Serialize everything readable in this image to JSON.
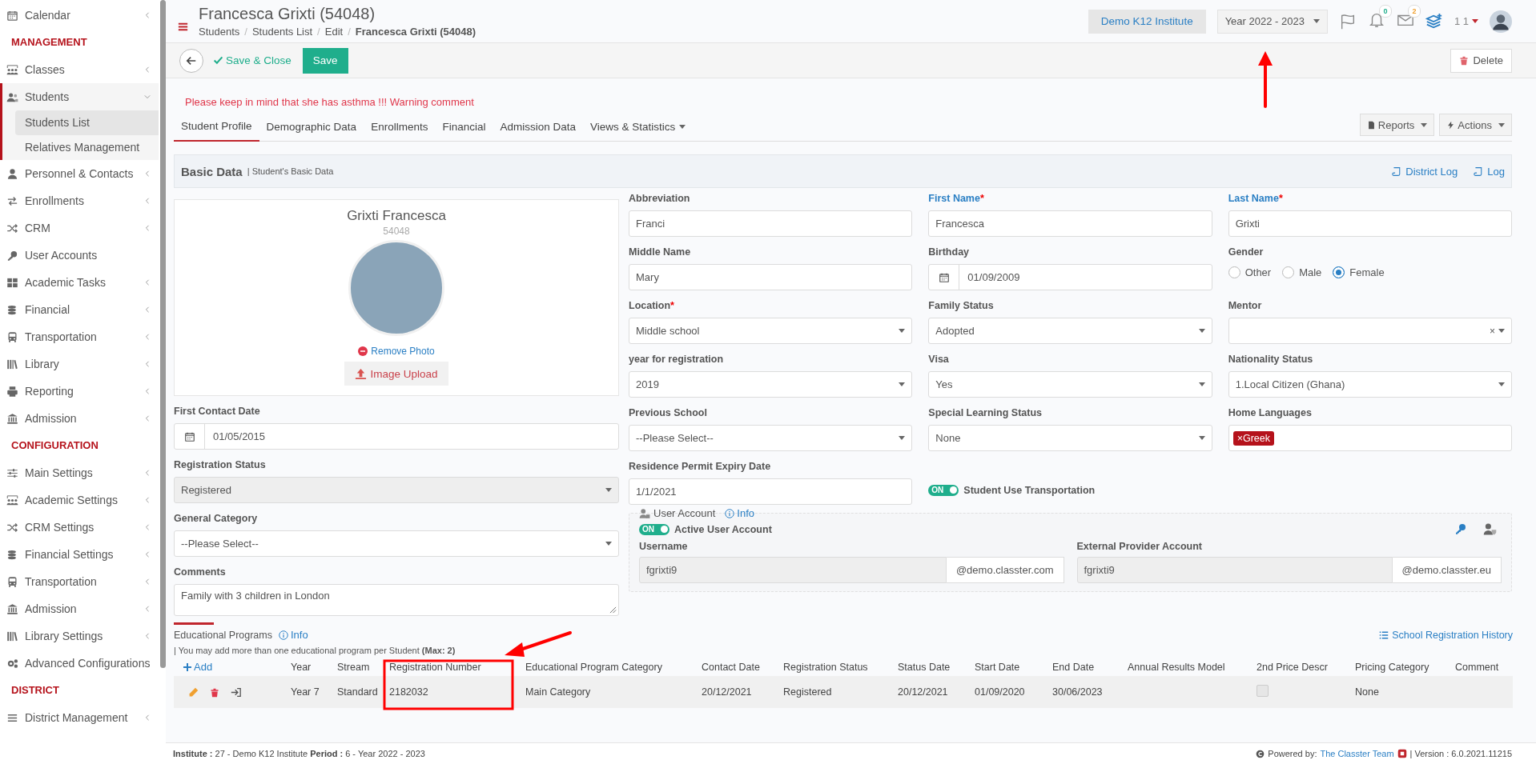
{
  "sidebar": {
    "items": [
      {
        "kind": "item",
        "label": "Calendar",
        "expanded": false
      },
      {
        "kind": "section",
        "label": "MANAGEMENT"
      },
      {
        "kind": "item",
        "label": "Classes",
        "expanded": false
      },
      {
        "kind": "item",
        "label": "Students",
        "expanded": true,
        "children": [
          {
            "label": "Students List",
            "selected": true
          },
          {
            "label": "Relatives Management",
            "selected": false
          }
        ]
      },
      {
        "kind": "item",
        "label": "Personnel & Contacts",
        "expanded": false
      },
      {
        "kind": "item",
        "label": "Enrollments",
        "expanded": false
      },
      {
        "kind": "item",
        "label": "CRM",
        "expanded": false
      },
      {
        "kind": "item",
        "label": "User Accounts"
      },
      {
        "kind": "item",
        "label": "Academic Tasks",
        "expanded": false
      },
      {
        "kind": "item",
        "label": "Financial",
        "expanded": false
      },
      {
        "kind": "item",
        "label": "Transportation",
        "expanded": false
      },
      {
        "kind": "item",
        "label": "Library",
        "expanded": false
      },
      {
        "kind": "item",
        "label": "Reporting",
        "expanded": false
      },
      {
        "kind": "item",
        "label": "Admission",
        "expanded": false
      },
      {
        "kind": "section",
        "label": "CONFIGURATION"
      },
      {
        "kind": "item",
        "label": "Main Settings",
        "expanded": false
      },
      {
        "kind": "item",
        "label": "Academic Settings",
        "expanded": false
      },
      {
        "kind": "item",
        "label": "CRM Settings",
        "expanded": false
      },
      {
        "kind": "item",
        "label": "Financial Settings",
        "expanded": false
      },
      {
        "kind": "item",
        "label": "Transportation",
        "expanded": false
      },
      {
        "kind": "item",
        "label": "Admission",
        "expanded": false
      },
      {
        "kind": "item",
        "label": "Library Settings",
        "expanded": false
      },
      {
        "kind": "item",
        "label": "Advanced Configurations"
      },
      {
        "kind": "section",
        "label": "DISTRICT"
      },
      {
        "kind": "item",
        "label": "District Management",
        "expanded": false
      }
    ]
  },
  "header": {
    "title": "Francesca Grixti (54048)",
    "breadcrumbs": [
      {
        "label": "Students",
        "current": false
      },
      {
        "label": "Students List",
        "current": false
      },
      {
        "label": "Edit",
        "current": false
      },
      {
        "label": "Francesca Grixti (54048)",
        "current": true
      }
    ],
    "breadcrumb_separator": "/",
    "institute": "Demo K12 Institute",
    "year": "Year 2022 - 2023",
    "notifications_count": "0",
    "messages_count": "2",
    "user_label": "1 1"
  },
  "toolbar": {
    "save_close": "Save & Close",
    "save": "Save",
    "delete": "Delete"
  },
  "warning": "Please keep in mind that she has asthma !!! Warning comment",
  "tabs": [
    {
      "label": "Student Profile",
      "selected": true,
      "dropdown": false
    },
    {
      "label": "Demographic Data",
      "selected": false,
      "dropdown": false
    },
    {
      "label": "Enrollments",
      "selected": false,
      "dropdown": false
    },
    {
      "label": "Financial",
      "selected": false,
      "dropdown": false
    },
    {
      "label": "Admission Data",
      "selected": false,
      "dropdown": false
    },
    {
      "label": "Views & Statistics",
      "selected": false,
      "dropdown": true
    }
  ],
  "tab_actions": [
    "Reports",
    "Actions"
  ],
  "panel": {
    "title": "Basic Data",
    "subtitle": "| Student's Basic Data",
    "links": [
      "District Log",
      "Log"
    ]
  },
  "form": {
    "required_mark": "*",
    "profile": {
      "name": "Grixti Francesca",
      "id": "54048",
      "remove_photo": "Remove Photo",
      "upload": "Image Upload"
    },
    "left_fields": [
      {
        "kind": "date",
        "label": "First Contact Date",
        "value": "01/05/2015"
      },
      {
        "kind": "select",
        "label": "Registration Status",
        "value": "Registered",
        "disabled": true
      },
      {
        "kind": "select",
        "label": "General Category",
        "value": "--Please Select--",
        "disabled": false
      },
      {
        "kind": "textarea",
        "label": "Comments",
        "value": "Family with 3 children in London"
      }
    ],
    "right_fields": [
      {
        "kind": "text",
        "label": "Abbreviation",
        "value": "Franci",
        "required": false,
        "emphasized": false
      },
      {
        "kind": "text",
        "label": "First Name",
        "value": "Francesca",
        "required": true,
        "emphasized": true
      },
      {
        "kind": "text",
        "label": "Last Name",
        "value": "Grixti",
        "required": true,
        "emphasized": true
      },
      {
        "kind": "text",
        "label": "Middle Name",
        "value": "Mary",
        "required": false,
        "emphasized": false
      },
      {
        "kind": "date",
        "label": "Birthday",
        "value": "01/09/2009",
        "required": false,
        "emphasized": false
      },
      {
        "kind": "radio",
        "label": "Gender",
        "required": false,
        "emphasized": false,
        "options": [
          {
            "label": "Other",
            "selected": false
          },
          {
            "label": "Male",
            "selected": false
          },
          {
            "label": "Female",
            "selected": true
          }
        ]
      },
      {
        "kind": "select",
        "label": "Location",
        "value": "Middle school",
        "required": true,
        "emphasized": false
      },
      {
        "kind": "select",
        "label": "Family Status",
        "value": "Adopted",
        "required": false,
        "emphasized": false
      },
      {
        "kind": "select",
        "label": "Mentor",
        "clear_glyph": "×",
        "required": false,
        "emphasized": false
      },
      {
        "kind": "select",
        "label": "year for registration",
        "value": "2019",
        "required": false,
        "emphasized": false
      },
      {
        "kind": "select",
        "label": "Visa",
        "value": "Yes",
        "required": false,
        "emphasized": false
      },
      {
        "kind": "select",
        "label": "Nationality Status",
        "value": "1.Local Citizen (Ghana)",
        "required": false,
        "emphasized": false
      },
      {
        "kind": "select",
        "label": "Previous School",
        "value": "--Please Select--",
        "required": false,
        "emphasized": false
      },
      {
        "kind": "select",
        "label": "Special Learning Status",
        "value": "None",
        "required": false,
        "emphasized": false
      },
      {
        "kind": "tags",
        "label": "Home Languages",
        "required": false,
        "emphasized": false,
        "tags": [
          {
            "remove_glyph": "×",
            "text": "Greek"
          }
        ]
      },
      {
        "kind": "text",
        "label": "Residence Permit Expiry Date",
        "value": "1/1/2021",
        "required": false,
        "emphasized": false
      },
      {
        "kind": "toggle",
        "label": "Student Use Transportation",
        "on": true,
        "switch_text": "ON"
      }
    ],
    "user_account": {
      "title": "User Account",
      "info": "Info",
      "toggle": {
        "on": true,
        "switch_text": "ON",
        "label": "Active User Account"
      },
      "accounts": [
        {
          "label": "Username",
          "value": "fgrixti9",
          "suffix": "@demo.classter.com"
        },
        {
          "label": "External Provider Account",
          "value": "fgrixti9",
          "suffix": "@demo.classter.eu"
        }
      ]
    }
  },
  "programs": {
    "title": "Educational Programs",
    "info": "Info",
    "note": "| You may add more than one educational program per Student **(Max: 2)**",
    "history_link": "School Registration History",
    "add": "Add",
    "columns": [
      "Year",
      "Stream",
      "Registration Number",
      "Educational Program Category",
      "Contact Date",
      "Registration Status",
      "Status Date",
      "Start Date",
      "End Date",
      "Annual Results Model",
      "2nd Price Descr",
      "Pricing Category",
      "Comment"
    ],
    "rows": [
      {
        "cells": [
          {
            "kind": "text",
            "text": "Year 7"
          },
          {
            "kind": "text",
            "text": "Standard"
          },
          {
            "kind": "text",
            "text": "2182032"
          },
          {
            "kind": "text",
            "text": "Main Category"
          },
          {
            "kind": "text",
            "text": "20/12/2021"
          },
          {
            "kind": "text",
            "text": "Registered"
          },
          {
            "kind": "text",
            "text": "20/12/2021"
          },
          {
            "kind": "text",
            "text": "01/09/2020"
          },
          {
            "kind": "text",
            "text": "30/06/2023"
          },
          {
            "kind": "blank"
          },
          {
            "kind": "checkbox",
            "checked": false
          },
          {
            "kind": "text",
            "text": "None"
          },
          {
            "kind": "blank"
          }
        ]
      }
    ]
  },
  "footer": {
    "info": "**Institute :** 27 - Demo K12 Institute **Period :** 6 - Year 2022 - 2023",
    "powered": "Powered by:",
    "team_link": "The Classter Team",
    "version": "| Version : 6.0.2021.11215"
  }
}
